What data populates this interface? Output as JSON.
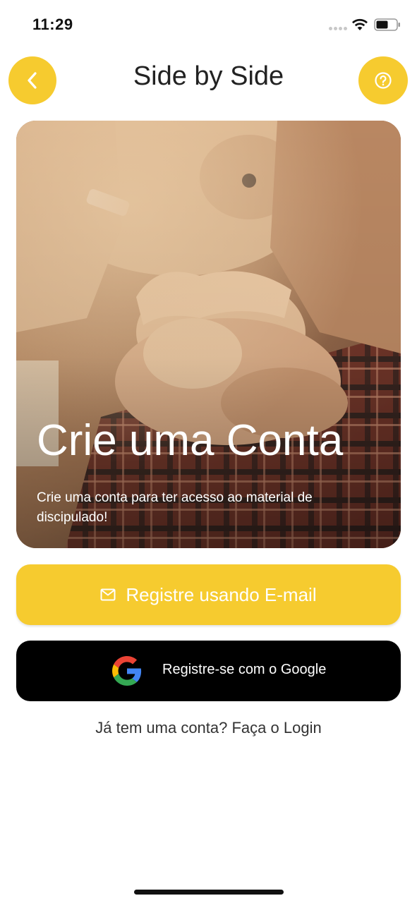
{
  "status_bar": {
    "time": "11:29",
    "icons": [
      "signal-icon",
      "wifi-icon",
      "battery-icon"
    ]
  },
  "header": {
    "title": "Side by Side",
    "back_icon": "chevron-left-icon",
    "help_icon": "help-circle-icon"
  },
  "hero": {
    "title": "Crie uma Conta",
    "subtitle": "Crie uma conta para ter acesso ao material de discipulado!",
    "image": "photo of clasped hands"
  },
  "actions": {
    "email_label": "Registre usando E-mail",
    "email_icon": "mail-icon",
    "google_label": "Registre-se com o Google",
    "google_icon": "google-logo-icon",
    "login_text": "Já tem uma conta? Faça o Login"
  },
  "colors": {
    "accent": "#f6cb2f",
    "google_button": "#000000",
    "background": "#ffffff"
  }
}
